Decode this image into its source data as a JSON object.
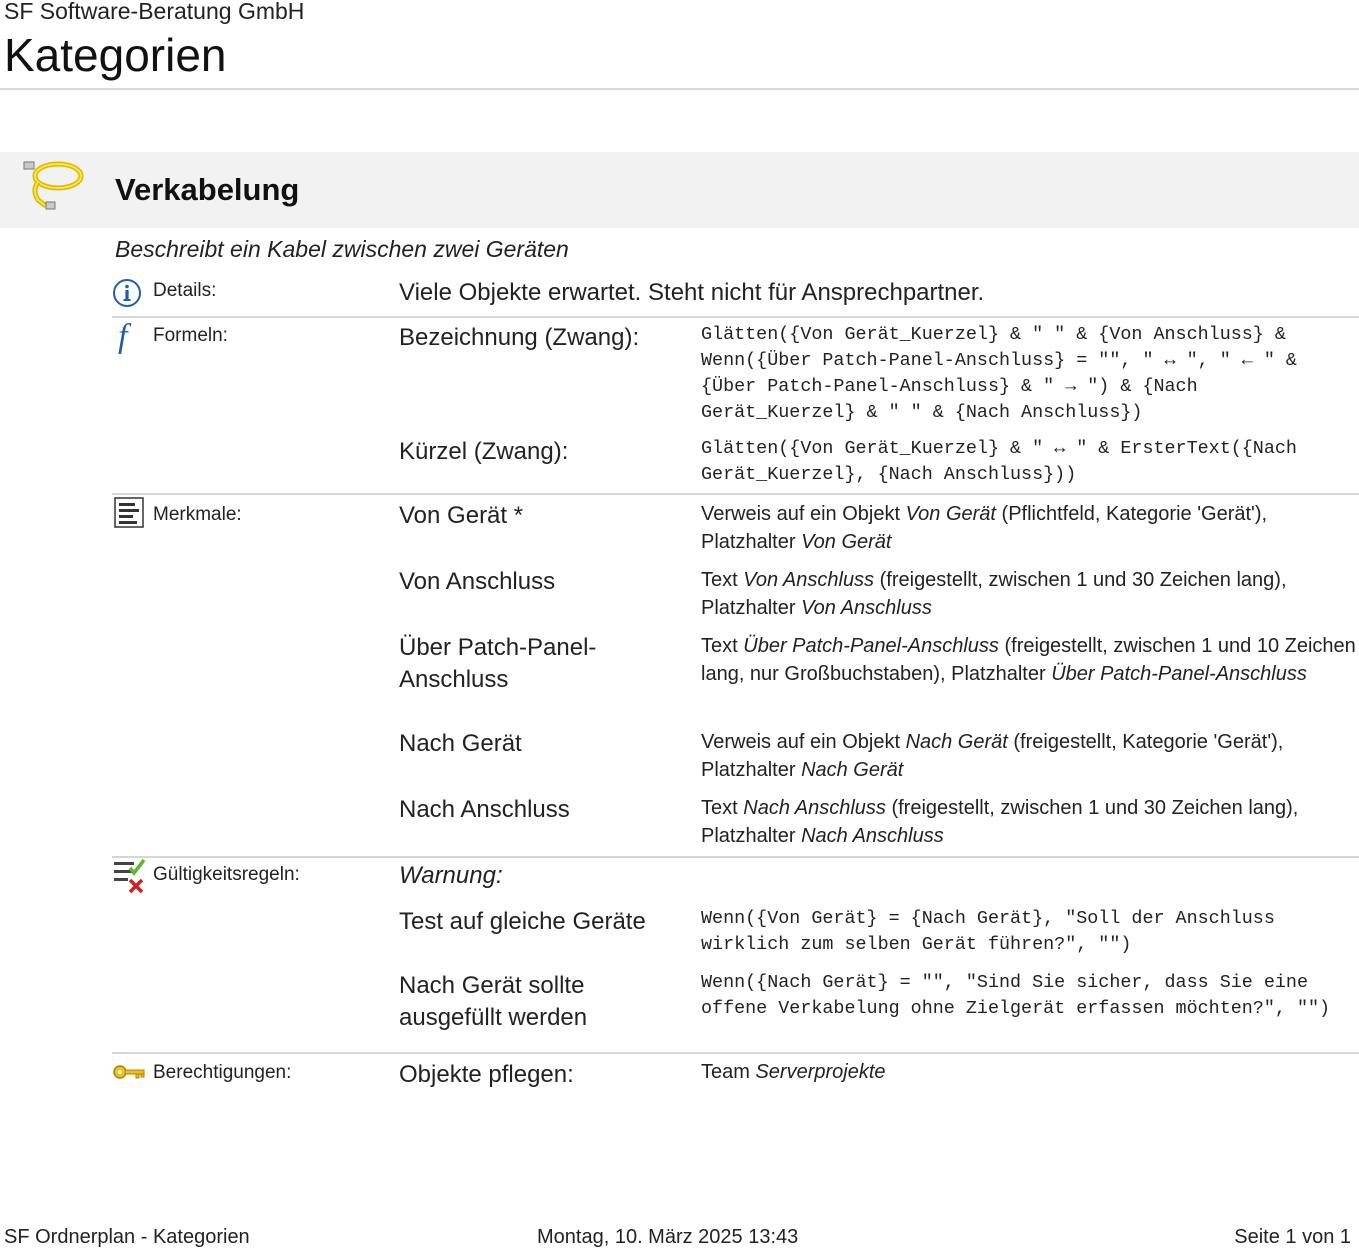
{
  "header": {
    "company": "SF Software-Beratung GmbH",
    "title": "Kategorien"
  },
  "category": {
    "name": "Verkabelung",
    "icon": "cable-icon",
    "description": "Beschreibt ein Kabel zwischen zwei Geräten"
  },
  "details": {
    "label": "Details:",
    "icon": "info-icon",
    "text": "Viele Objekte erwartet. Steht nicht für Ansprechpartner."
  },
  "formulas": {
    "label": "Formeln:",
    "icon": "function-icon",
    "items": [
      {
        "key": "Bezeichnung (Zwang):",
        "value": "Glätten({Von Gerät_Kuerzel} & \" \" & {Von Anschluss} & Wenn({Über Patch-Panel-Anschluss} = \"\", \" ↔ \", \" ← \" & {Über Patch-Panel-Anschluss} & \" → \") & {Nach Gerät_Kuerzel} & \" \" & {Nach Anschluss})"
      },
      {
        "key": "Kürzel (Zwang):",
        "value": "Glätten({Von Gerät_Kuerzel} & \" ↔ \" & ErsterText({Nach Gerät_Kuerzel}, {Nach Anschluss}))"
      }
    ]
  },
  "attributes": {
    "label": "Merkmale:",
    "icon": "list-icon",
    "items": [
      {
        "key": "Von Gerät *",
        "p1": "Verweis auf ein Objekt ",
        "i1": "Von Gerät",
        "p2": " (Pflichtfeld, Kategorie 'Gerät'), Platzhalter ",
        "i2": "Von Gerät"
      },
      {
        "key": "Von Anschluss",
        "p1": "Text ",
        "i1": "Von Anschluss",
        "p2": " (freigestellt, zwischen 1 und 30 Zeichen lang), Platzhalter ",
        "i2": "Von Anschluss"
      },
      {
        "key": "Über Patch-Panel-Anschluss",
        "p1": "Text ",
        "i1": "Über Patch-Panel-Anschluss",
        "p2": " (freigestellt, zwischen 1 und 10 Zeichen lang, nur Großbuchstaben), Platzhalter ",
        "i2": "Über Patch-Panel-Anschluss"
      },
      {
        "key": "Nach Gerät",
        "p1": "Verweis auf ein Objekt ",
        "i1": "Nach Gerät",
        "p2": " (freigestellt, Kategorie 'Gerät'), Platzhalter ",
        "i2": "Nach Gerät"
      },
      {
        "key": "Nach Anschluss",
        "p1": "Text ",
        "i1": "Nach Anschluss",
        "p2": " (freigestellt, zwischen 1 und 30 Zeichen lang), Platzhalter ",
        "i2": "Nach Anschluss"
      }
    ]
  },
  "validation": {
    "label": "Gültigkeitsregeln:",
    "icon": "validation-icon",
    "heading": "Warnung:",
    "items": [
      {
        "key": "Test auf gleiche Geräte",
        "value": "Wenn({Von Gerät} = {Nach Gerät}, \"Soll der Anschluss wirklich zum selben Gerät führen?\", \"\")"
      },
      {
        "key": "Nach Gerät sollte ausgefüllt werden",
        "value": "Wenn({Nach Gerät} = \"\", \"Sind Sie sicher, dass Sie eine offene Verkabelung ohne Zielgerät erfassen möchten?\", \"\")"
      }
    ]
  },
  "permissions": {
    "label": "Berechtigungen:",
    "icon": "key-icon",
    "key": "Objekte pflegen:",
    "prefix": "Team ",
    "team": "Serverprojekte"
  },
  "footer": {
    "left": "SF Ordnerplan - Kategorien",
    "center": "Montag, 10. März 2025 13:43",
    "right": "Seite 1 von 1"
  }
}
